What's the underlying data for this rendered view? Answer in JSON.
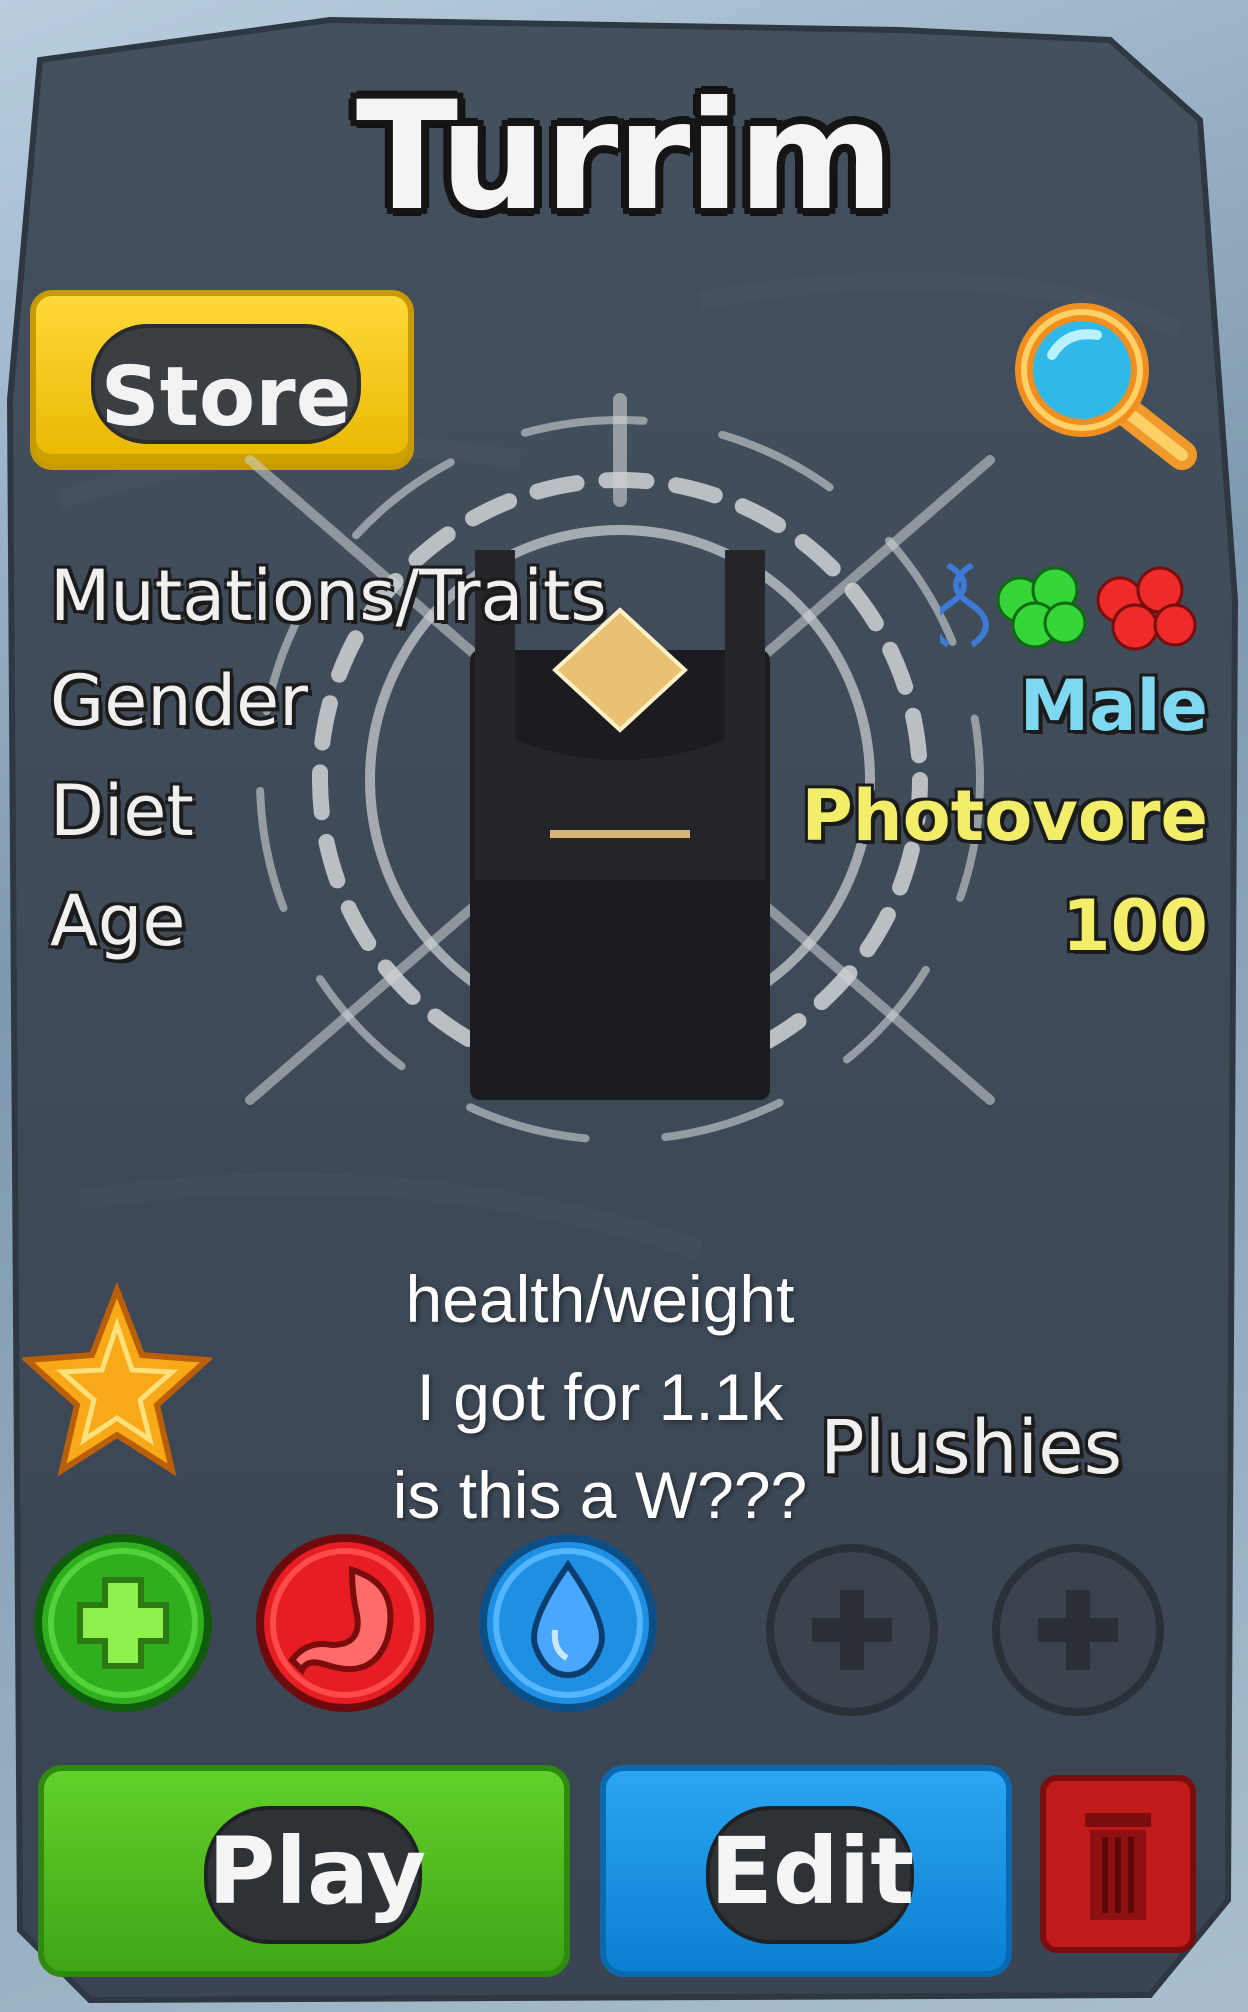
{
  "creature": {
    "name": "Turrim"
  },
  "store": {
    "label": "Store"
  },
  "info": {
    "rows": [
      {
        "label": "Mutations/Traits",
        "value": ""
      },
      {
        "label": "Gender",
        "value": "Male",
        "color": "#7fd8f2"
      },
      {
        "label": "Diet",
        "value": "Photovore",
        "color": "#f3ee6a"
      },
      {
        "label": "Age",
        "value": "100",
        "color": "#f3ee6a"
      }
    ],
    "mutation_icons": [
      "dna-icon",
      "green-mutation-icon",
      "red-mutation-icon"
    ]
  },
  "caption": {
    "line1": "health/weight",
    "line2": "I got for 1.1k",
    "line3": "is this a W???"
  },
  "plushies": {
    "label": "Plushies"
  },
  "stats": [
    "health-icon",
    "hunger-icon",
    "thirst-icon"
  ],
  "plush_slots": [
    "add-plush-slot-1",
    "add-plush-slot-2"
  ],
  "actions": {
    "play_label": "Play",
    "edit_label": "Edit"
  },
  "colors": {
    "panel": "#3d4754",
    "store": "#f5c400",
    "play": "#4cbb1e",
    "edit": "#1592e0",
    "delete": "#c21a1a"
  }
}
